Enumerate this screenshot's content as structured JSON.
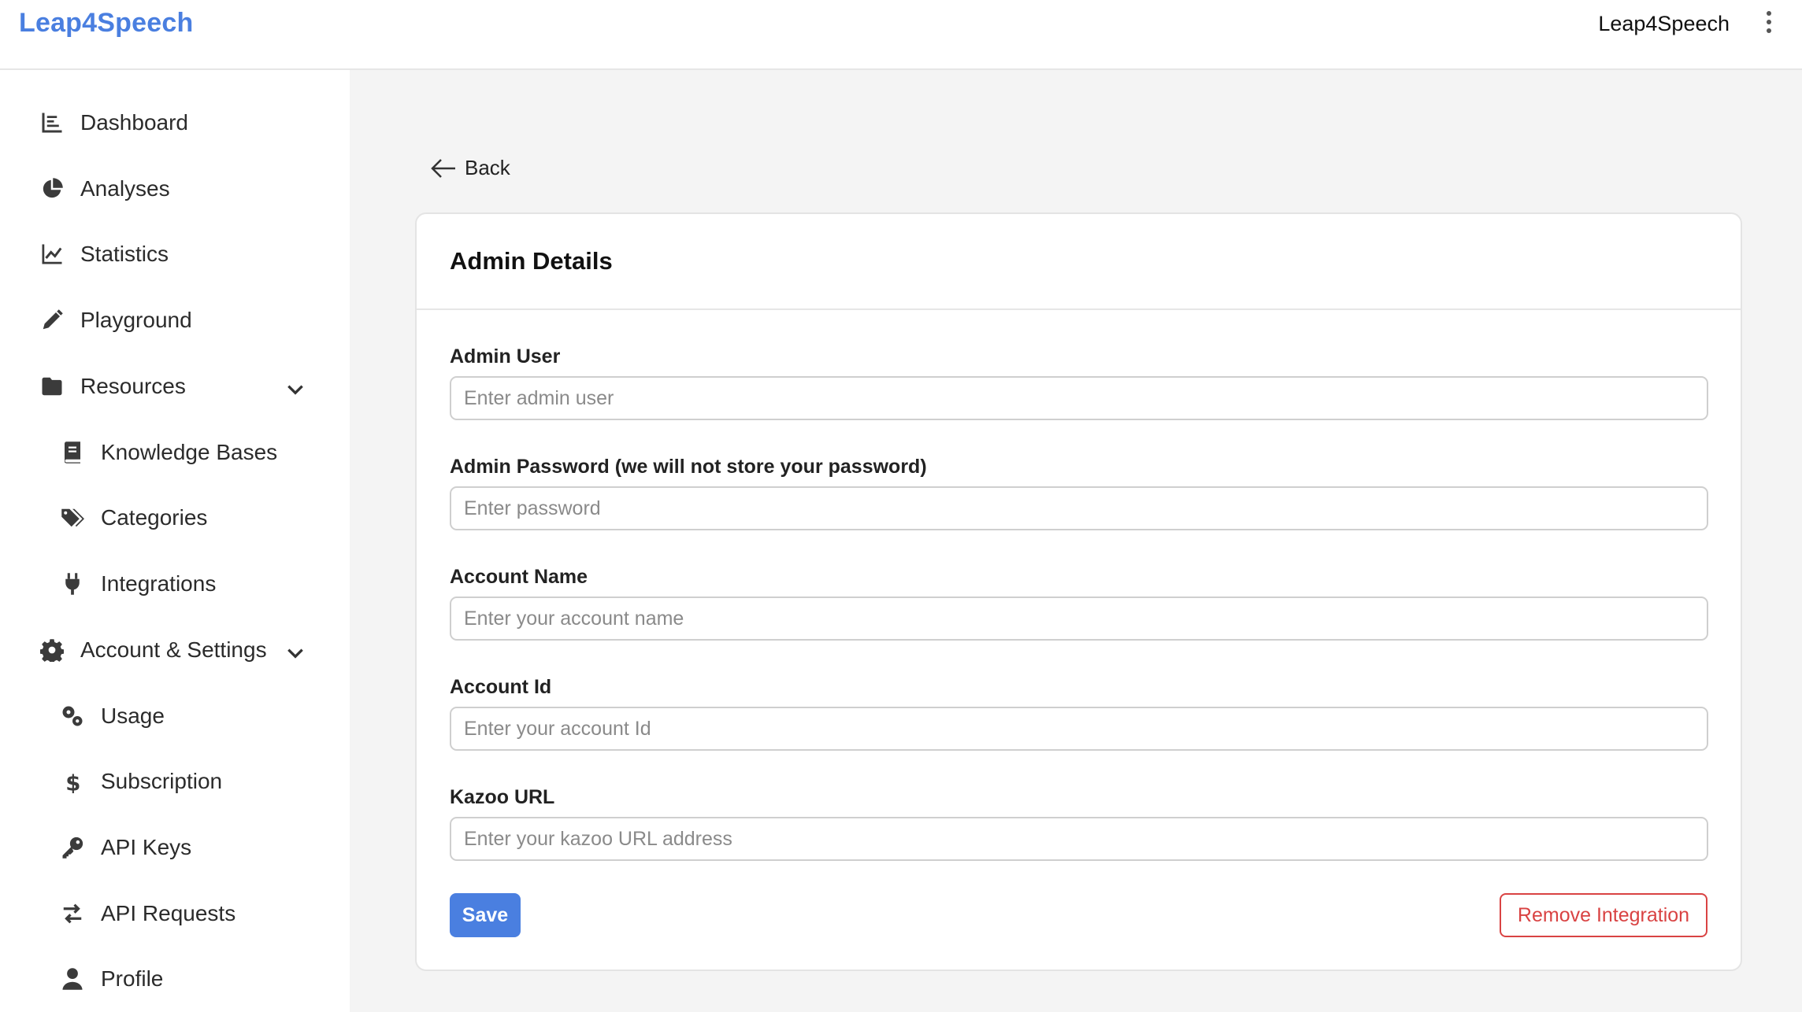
{
  "header": {
    "brand": "Leap4Speech",
    "account_name": "Leap4Speech",
    "menu_icon": "kebab-menu-icon"
  },
  "sidebar": {
    "items": [
      {
        "label": "Dashboard",
        "icon": "chart-bar-icon"
      },
      {
        "label": "Analyses",
        "icon": "pie-chart-icon"
      },
      {
        "label": "Statistics",
        "icon": "line-chart-icon"
      },
      {
        "label": "Playground",
        "icon": "pencil-icon"
      },
      {
        "label": "Resources",
        "icon": "folder-icon",
        "expanded": true
      },
      {
        "label": "Knowledge Bases",
        "icon": "book-icon"
      },
      {
        "label": "Categories",
        "icon": "tags-icon"
      },
      {
        "label": "Integrations",
        "icon": "plug-icon"
      },
      {
        "label": "Account & Settings",
        "icon": "gear-icon",
        "expanded": true
      },
      {
        "label": "Usage",
        "icon": "gears-icon"
      },
      {
        "label": "Subscription",
        "icon": "dollar-icon"
      },
      {
        "label": "API Keys",
        "icon": "key-icon"
      },
      {
        "label": "API Requests",
        "icon": "arrows-exchange-icon"
      },
      {
        "label": "Profile",
        "icon": "user-icon"
      }
    ]
  },
  "main": {
    "back_label": "Back",
    "card_title": "Admin Details",
    "fields": [
      {
        "label": "Admin User",
        "placeholder": "Enter admin user",
        "value": ""
      },
      {
        "label": "Admin Password (we will not store your password)",
        "placeholder": "Enter password",
        "value": ""
      },
      {
        "label": "Account Name",
        "placeholder": "Enter your account name",
        "value": ""
      },
      {
        "label": "Account Id",
        "placeholder": "Enter your account Id",
        "value": ""
      },
      {
        "label": "Kazoo URL",
        "placeholder": "Enter your kazoo URL address",
        "value": ""
      }
    ],
    "save_label": "Save",
    "remove_label": "Remove Integration"
  },
  "colors": {
    "accent": "#4a7fe0",
    "danger": "#d94343",
    "background": "#f4f4f4"
  }
}
